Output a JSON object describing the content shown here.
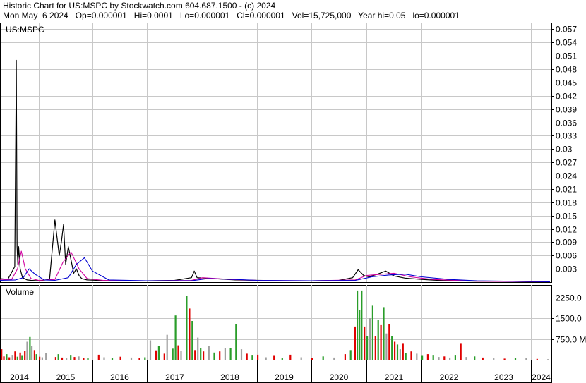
{
  "header": {
    "line1": "Historic Chart for US:MSPC by Stockwatch.com 604.687.1500 - (c) 2024",
    "line2": "Mon May  6 2024   Op=0.000001   Hi=0.0001   Lo=0.000001   Cl=0.000001   Vol=15,725,000   Year hi=0.05   lo=0.000001"
  },
  "colors": {
    "up": "#2a9d2a",
    "down": "#e00000",
    "neutral": "#a0a0a0",
    "price": "#000000",
    "ma_short": "#d000a0",
    "ma_long": "#0000d0",
    "grid": "#c8c8c8"
  },
  "chart_data": [
    {
      "type": "line",
      "panel_label": "US:MSPC",
      "y_ticks": [
        "0.057",
        "0.054",
        "0.051",
        "0.048",
        "0.045",
        "0.042",
        "0.039",
        "0.036",
        "0.033",
        "0.03",
        "0.027",
        "0.024",
        "0.021",
        "0.018",
        "0.015",
        "0.012",
        "0.009",
        "0.006",
        "0.003"
      ],
      "ylim": [
        0,
        0.0585
      ],
      "x_labels": [
        "2014",
        "2015",
        "2016",
        "2017",
        "2018",
        "2019",
        "2020",
        "2021",
        "2022",
        "2023",
        "2024"
      ],
      "series": [
        {
          "x": [
            2014.0,
            2014.2,
            2014.38,
            2014.42,
            2014.44,
            2014.46,
            2014.48,
            2014.52,
            2014.58,
            2014.7,
            2014.8,
            2015.0,
            2015.2,
            2015.3,
            2015.38,
            2015.42,
            2015.46,
            2015.5,
            2015.55,
            2015.6,
            2015.65,
            2015.7,
            2015.75,
            2015.8,
            2015.9,
            2016.1,
            2016.5,
            2017.0,
            2017.5,
            2017.8,
            2017.85,
            2017.9,
            2018.2,
            2018.6,
            2019.0,
            2019.5,
            2020.0,
            2020.5,
            2020.75,
            2020.85,
            2020.95,
            2021.05,
            2021.2,
            2021.35,
            2021.5,
            2021.7,
            2022.0,
            2022.3,
            2022.6,
            2023.0,
            2023.5,
            2024.0,
            2024.35
          ],
          "values": [
            0.0008,
            0.0006,
            0.0035,
            0.05,
            0.008,
            0.004,
            0.008,
            0.003,
            0.001,
            0.0005,
            0.0004,
            0.0003,
            0.0006,
            0.014,
            0.006,
            0.009,
            0.013,
            0.004,
            0.008,
            0.005,
            0.002,
            0.003,
            0.0015,
            0.0008,
            0.0005,
            0.0004,
            0.0003,
            0.0003,
            0.0004,
            0.001,
            0.0025,
            0.001,
            0.0008,
            0.0005,
            0.0004,
            0.0003,
            0.0003,
            0.0004,
            0.001,
            0.0028,
            0.0015,
            0.0012,
            0.0018,
            0.0025,
            0.0014,
            0.0009,
            0.0006,
            0.0004,
            0.0003,
            0.0002,
            0.0002,
            0.0001,
            1e-06
          ]
        },
        {
          "x": [
            2014.0,
            2014.3,
            2014.45,
            2014.55,
            2014.65,
            2014.8,
            2015.0,
            2015.3,
            2015.45,
            2015.6,
            2015.75,
            2015.9,
            2016.2,
            2017.0,
            2017.8,
            2018.0,
            2018.5,
            2019.0,
            2020.0,
            2020.8,
            2021.0,
            2021.3,
            2021.5,
            2021.8,
            2022.2,
            2023.0,
            2024.35
          ],
          "values": [
            0.0005,
            0.0006,
            0.003,
            0.007,
            0.003,
            0.0008,
            0.0004,
            0.0006,
            0.0045,
            0.0068,
            0.003,
            0.0008,
            0.0004,
            0.0003,
            0.0004,
            0.001,
            0.0006,
            0.0004,
            0.0003,
            0.0005,
            0.0015,
            0.0018,
            0.002,
            0.0012,
            0.0006,
            0.0002,
            0.0001
          ]
        },
        {
          "x": [
            2014.0,
            2014.4,
            2014.6,
            2014.75,
            2014.9,
            2015.1,
            2015.3,
            2015.55,
            2015.7,
            2015.85,
            2016.0,
            2016.3,
            2017.0,
            2017.8,
            2018.1,
            2018.6,
            2019.0,
            2020.0,
            2020.8,
            2021.1,
            2021.4,
            2021.7,
            2022.0,
            2022.5,
            2023.0,
            2024.35
          ],
          "values": [
            0.0004,
            0.0005,
            0.001,
            0.003,
            0.0018,
            0.0005,
            0.0004,
            0.001,
            0.004,
            0.0055,
            0.0025,
            0.0005,
            0.0003,
            0.0003,
            0.0008,
            0.0006,
            0.0004,
            0.0003,
            0.0004,
            0.0012,
            0.0016,
            0.0018,
            0.0012,
            0.0006,
            0.0003,
            0.0001
          ]
        }
      ]
    },
    {
      "type": "bar",
      "panel_label": "Volume",
      "y_ticks": [
        "2250.0",
        "1500.0",
        "750.0 M"
      ],
      "ylim": [
        0,
        2700
      ],
      "x": [
        2014.02,
        2014.08,
        2014.15,
        2014.22,
        2014.3,
        2014.37,
        2014.43,
        2014.5,
        2014.55,
        2014.62,
        2014.68,
        2014.75,
        2014.8,
        2014.87,
        2014.92,
        2015.0,
        2015.05,
        2015.12,
        2015.3,
        2015.35,
        2015.42,
        2015.5,
        2015.58,
        2015.65,
        2015.73,
        2015.82,
        2015.9,
        2016.1,
        2016.2,
        2016.35,
        2016.5,
        2016.7,
        2016.85,
        2016.95,
        2017.05,
        2017.15,
        2017.2,
        2017.3,
        2017.35,
        2017.45,
        2017.5,
        2017.55,
        2017.6,
        2017.7,
        2017.75,
        2017.8,
        2017.85,
        2017.9,
        2017.95,
        2018.0,
        2018.1,
        2018.2,
        2018.3,
        2018.4,
        2018.5,
        2018.6,
        2018.7,
        2018.8,
        2018.9,
        2019.0,
        2019.15,
        2019.3,
        2019.45,
        2019.6,
        2019.8,
        2020.0,
        2020.2,
        2020.4,
        2020.6,
        2020.7,
        2020.78,
        2020.82,
        2020.86,
        2020.9,
        2020.95,
        2021.0,
        2021.05,
        2021.1,
        2021.15,
        2021.2,
        2021.25,
        2021.3,
        2021.35,
        2021.4,
        2021.45,
        2021.5,
        2021.55,
        2021.6,
        2021.65,
        2021.7,
        2021.8,
        2021.9,
        2022.0,
        2022.1,
        2022.2,
        2022.3,
        2022.4,
        2022.5,
        2022.6,
        2022.7,
        2022.8,
        2022.95,
        2023.1,
        2023.3,
        2023.5,
        2023.7,
        2023.9,
        2024.1,
        2024.3
      ],
      "values": [
        380,
        120,
        200,
        90,
        150,
        300,
        110,
        260,
        140,
        320,
        650,
        820,
        500,
        350,
        200,
        110,
        90,
        250,
        100,
        200,
        80,
        60,
        150,
        100,
        120,
        70,
        60,
        180,
        90,
        60,
        110,
        80,
        50,
        90,
        700,
        340,
        500,
        220,
        900,
        400,
        1600,
        520,
        330,
        2300,
        1850,
        1400,
        350,
        800,
        420,
        300,
        500,
        260,
        300,
        420,
        420,
        1280,
        380,
        220,
        150,
        180,
        90,
        140,
        60,
        180,
        90,
        60,
        120,
        80,
        200,
        350,
        1200,
        2500,
        1800,
        2500,
        1200,
        850,
        1500,
        1950,
        850,
        1450,
        1250,
        1900,
        950,
        1300,
        850,
        650,
        550,
        380,
        600,
        250,
        300,
        220,
        140,
        200,
        150,
        100,
        120,
        80,
        150,
        600,
        100,
        120,
        80,
        60,
        40,
        70,
        50,
        30,
        20
      ],
      "direction": [
        "down",
        "down",
        "up",
        "down",
        "neutral",
        "down",
        "up",
        "down",
        "up",
        "down",
        "neutral",
        "up",
        "neutral",
        "down",
        "up",
        "down",
        "neutral",
        "neutral",
        "down",
        "up",
        "down",
        "neutral",
        "up",
        "down",
        "neutral",
        "down",
        "up",
        "down",
        "neutral",
        "up",
        "down",
        "neutral",
        "down",
        "up",
        "neutral",
        "down",
        "up",
        "down",
        "neutral",
        "up",
        "up",
        "down",
        "neutral",
        "up",
        "down",
        "up",
        "down",
        "neutral",
        "up",
        "down",
        "neutral",
        "up",
        "down",
        "neutral",
        "up",
        "up",
        "neutral",
        "down",
        "up",
        "down",
        "neutral",
        "down",
        "up",
        "down",
        "neutral",
        "down",
        "up",
        "neutral",
        "down",
        "up",
        "down",
        "up",
        "up",
        "up",
        "down",
        "up",
        "neutral",
        "up",
        "down",
        "up",
        "down",
        "up",
        "neutral",
        "down",
        "up",
        "down",
        "up",
        "neutral",
        "down",
        "up",
        "down",
        "neutral",
        "up",
        "down",
        "up",
        "neutral",
        "down",
        "neutral",
        "up",
        "down",
        "neutral",
        "up",
        "down",
        "neutral",
        "down",
        "up",
        "neutral",
        "down"
      ]
    }
  ]
}
